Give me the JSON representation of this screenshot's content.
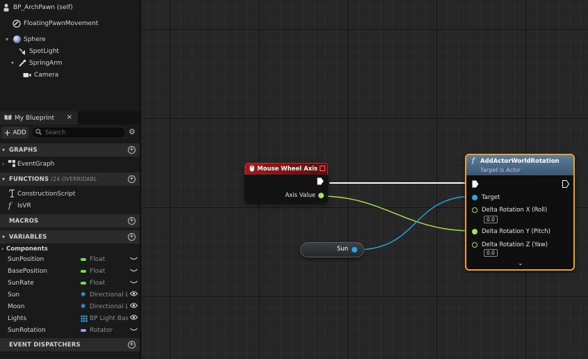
{
  "components": {
    "root": "BP_ArchPawn (self)",
    "items": [
      {
        "label": "FloatingPawnMovement"
      },
      {
        "label": "Sphere"
      },
      {
        "label": "SpotLight"
      },
      {
        "label": "SpringArm"
      },
      {
        "label": "Camera"
      }
    ]
  },
  "my_blueprint": {
    "tab_label": "My Blueprint",
    "close_glyph": "×",
    "add_label": "ADD",
    "search_placeholder": "Search",
    "sections": {
      "graphs": "GRAPHS",
      "functions": "FUNCTIONS",
      "functions_note": "(24 OVERRIDABL",
      "macros": "MACROS",
      "variables": "VARIABLES",
      "event_dispatchers": "EVENT DISPATCHERS"
    },
    "graphs": [
      "EventGraph"
    ],
    "functions": [
      "ConstructionScript",
      "IsVR"
    ],
    "components_group": "Components",
    "variables": [
      {
        "name": "SunPosition",
        "type": "Float",
        "color": "#7ed957",
        "icon": "eye-closed-icon"
      },
      {
        "name": "BasePosition",
        "type": "Float",
        "color": "#7ed957",
        "icon": "eye-closed-icon"
      },
      {
        "name": "SunRate",
        "type": "Float",
        "color": "#7ed957",
        "icon": "eye-closed-icon"
      },
      {
        "name": "Sun",
        "type": "Directional Li",
        "color": "#2aa7e0",
        "icon": "eye-open-icon"
      },
      {
        "name": "Moon",
        "type": "Directional Li",
        "color": "#2aa7e0",
        "icon": "eye-open-icon"
      },
      {
        "name": "Lights",
        "type": "BP Light Base",
        "color": "#2aa7e0",
        "icon": "eye-open-icon"
      },
      {
        "name": "SunRotation",
        "type": "Rotator",
        "color": "#9a9ae6",
        "icon": "eye-closed-icon"
      }
    ]
  },
  "graph": {
    "mouse_wheel_node": {
      "title": "Mouse Wheel Axis",
      "output_label": "Axis Value",
      "header_color": "#8a1616"
    },
    "sun_node": {
      "label": "Sun"
    },
    "rotation_node": {
      "title": "AddActorWorldRotation",
      "subtitle": "Target is Actor",
      "pins": {
        "target": "Target",
        "roll": "Delta Rotation X (Roll)",
        "roll_value": "0.0",
        "pitch": "Delta Rotation Y (Pitch)",
        "yaw": "Delta Rotation Z (Yaw)",
        "yaw_value": "0.0"
      },
      "header_color": "#4f6f8e",
      "selected_border": "#f0a41e"
    },
    "colors": {
      "float_pin": "#7ed957",
      "object_pin": "#2aa7e0",
      "exec": "#ffffff"
    }
  }
}
